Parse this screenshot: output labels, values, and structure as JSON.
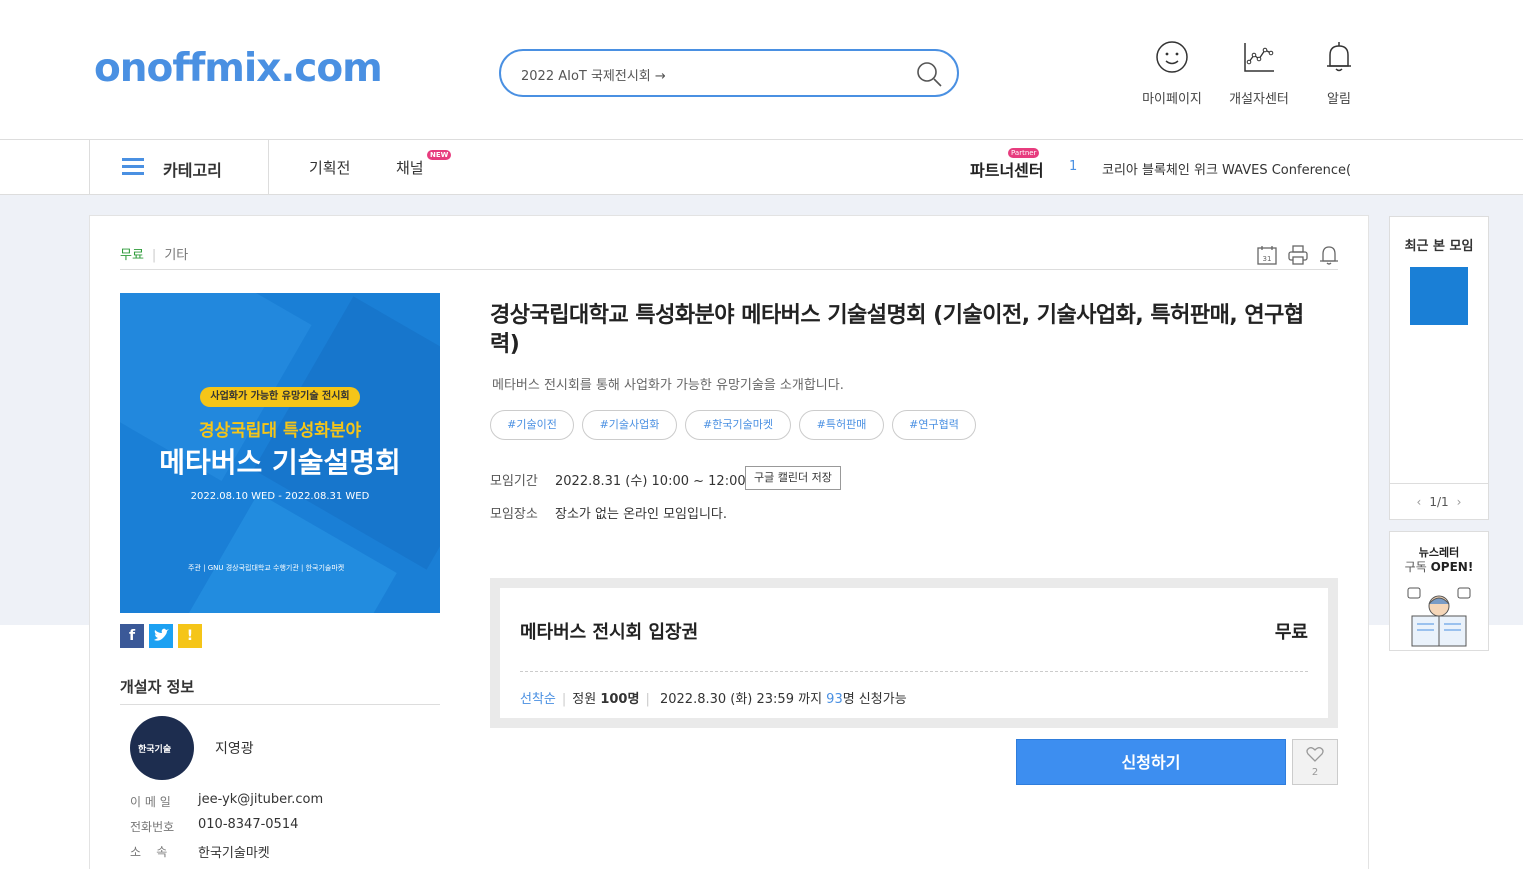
{
  "header": {
    "logo": "onoffmix.com",
    "search_value": "2022 AIoT 국제전시회 →",
    "icons": [
      {
        "name": "smile-icon",
        "label": "마이페이지"
      },
      {
        "name": "chart-icon",
        "label": "개설자센터"
      },
      {
        "name": "bell-icon",
        "label": "알림"
      }
    ]
  },
  "nav": {
    "category": "카테고리",
    "links": [
      "기획전",
      "채널"
    ],
    "new_badge": "NEW",
    "partner": "파트너센터",
    "partner_badge": "Partner",
    "rank_number": "1",
    "rank_text": "코리아 블록체인 위크 WAVES Conference(..."
  },
  "breadcrumb": {
    "price_type": "무료",
    "category": "기타"
  },
  "tool_icons": [
    "calendar-icon",
    "print-icon",
    "alarm-icon"
  ],
  "calendar_day": "31",
  "poster": {
    "pill": "사업화가 가능한 유망기술 전시회",
    "line1": "경상국립대 특성화분야",
    "line2": "메타버스 기술설명회",
    "dates": "2022.08.10 WED - 2022.08.31 WED",
    "footer": "주관 | GNU 경상국립대학교    수행기관 | 한국기술마켓"
  },
  "sns": [
    "facebook",
    "twitter",
    "kakaostory"
  ],
  "host": {
    "section_title": "개설자 정보",
    "avatar_text": "한국기술",
    "name": "지영광",
    "email_label": "이 메 일",
    "email": "jee-yk@jituber.com",
    "phone_label": "전화번호",
    "phone": "010-8347-0514",
    "org_label": "소    속",
    "org": "한국기술마켓"
  },
  "event": {
    "title": "경상국립대학교 특성화분야 메타버스 기술설명회 (기술이전, 기술사업화, 특허판매, 연구협력)",
    "subtitle": "메타버스 전시회를 통해 사업화가 가능한 유망기술을 소개합니다.",
    "tags": [
      "#기술이전",
      "#기술사업화",
      "#한국기술마켓",
      "#특허판매",
      "#연구협력"
    ],
    "period_label": "모임기간",
    "period": "2022.8.31 (수) 10:00 ~ 12:00",
    "gcal_button": "구글 캘린더 저장",
    "place_label": "모임장소",
    "place": "장소가 없는 온라인 모임입니다."
  },
  "ticket": {
    "name": "메타버스 전시회 입장권",
    "price": "무료",
    "order_type": "선착순",
    "capacity_label": "정원",
    "capacity": "100명",
    "deadline": "2022.8.30 (화) 23:59 까지",
    "remaining": "93",
    "remaining_suffix": "명 신청가능"
  },
  "actions": {
    "apply": "신청하기",
    "like_count": "2"
  },
  "recent": {
    "title": "최근 본 모임",
    "page": "1/1"
  },
  "newsletter": {
    "line1": "뉴스레터",
    "line2_prefix": "구독",
    "line2_bold": "OPEN!"
  },
  "colors": {
    "brand": "#4a90e2",
    "apply": "#3d8ef0",
    "free": "#2e9b3a",
    "badge": "#e73c7e"
  }
}
